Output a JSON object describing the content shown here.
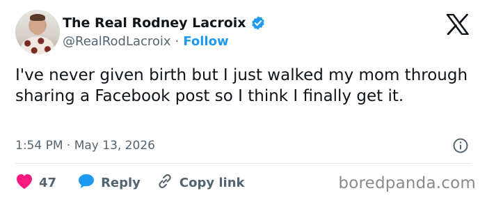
{
  "author": {
    "display_name": "The Real Rodney Lacroix",
    "handle": "@RealRodLacroix",
    "separator": "·",
    "follow_label": "Follow",
    "verified": true
  },
  "tweet": {
    "text": "I've never given birth but I just walked my mom through sharing a Facebook post so I think I finally get it.",
    "time": "1:54 PM",
    "date_separator": "·",
    "date": "May 13, 2026"
  },
  "actions": {
    "like_count": "47",
    "reply_label": "Reply",
    "copy_link_label": "Copy link"
  },
  "watermark": "boredpanda.com",
  "colors": {
    "accent": "#1d9bf0",
    "like": "#f91880",
    "muted": "#536471",
    "text": "#0f1419"
  },
  "icons": [
    "x-logo-icon",
    "verified-badge-icon",
    "info-icon",
    "heart-icon",
    "reply-bubble-icon",
    "link-icon"
  ]
}
